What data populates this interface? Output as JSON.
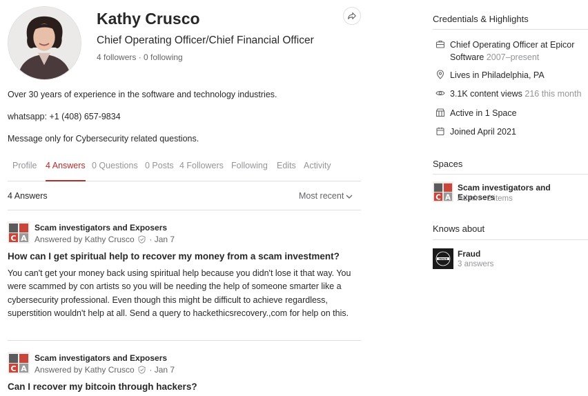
{
  "profile": {
    "name": "Kathy Crusco",
    "headline": "Chief Operating Officer/Chief Financial Officer",
    "follow_stats": "4 followers · 0 following",
    "bio_lines": [
      "Over 30 years of experience in the software and technology industries.",
      "whatsapp: +1 (408) 657-9834",
      "Message only for Cybersecurity related questions."
    ]
  },
  "tabs": [
    {
      "label": "Profile",
      "active": false
    },
    {
      "label": "4 Answers",
      "active": true
    },
    {
      "label": "0 Questions",
      "active": false
    },
    {
      "label": "0 Posts",
      "active": false
    },
    {
      "label": "4 Followers",
      "active": false
    },
    {
      "label": "Following",
      "active": false
    },
    {
      "label": "Edits",
      "active": false
    },
    {
      "label": "Activity",
      "active": false
    }
  ],
  "feed": {
    "count_label": "4 Answers",
    "sort_label": "Most recent",
    "answers": [
      {
        "space": "Scam investigators and Exposers",
        "answered_by": "Answered by Kathy Crusco",
        "date": "· Jan 7",
        "question": "How can I get spiritual help to recover my money from a scam investment?",
        "body": "You can't get your money back using spiritual help because you didn't lose it that way. You were scammed by con artists so you will be needing the help of someone smarter like a cybersecurity professional. Even though this might be difficult to achieve regardless, superstition wouldn't help at all. Send a query to hackethicsrecovery.,com for help on this."
      },
      {
        "space": "Scam investigators and Exposers",
        "answered_by": "Answered by Kathy Crusco",
        "date": "· Jan 7",
        "question": "Can I recover my bitcoin through hackers?",
        "body": ""
      }
    ]
  },
  "sidebar": {
    "credentials_title": "Credentials & Highlights",
    "credentials": [
      {
        "icon": "briefcase-icon",
        "text": "Chief Operating Officer at Epicor Software",
        "muted": "2007–present"
      },
      {
        "icon": "location-pin-icon",
        "text": "Lives in Philadelphia, PA",
        "muted": ""
      },
      {
        "icon": "eye-icon",
        "text": "3.1K content views",
        "muted": "216 this month"
      },
      {
        "icon": "spaces-icon",
        "text": "Active in 1 Space",
        "muted": ""
      },
      {
        "icon": "calendar-icon",
        "text": "Joined April 2021",
        "muted": ""
      }
    ],
    "spaces_title": "Spaces",
    "spaces": [
      {
        "name": "Scam investigators and Exposers",
        "sub": "Admin · 2 items"
      }
    ],
    "knows_title": "Knows about",
    "topics": [
      {
        "name": "Fraud",
        "sub": "3 answers",
        "logo_text": "FRAUD"
      }
    ]
  },
  "colors": {
    "accent": "#b92b27",
    "text": "#282829",
    "muted": "#939598",
    "divider": "#dee0e1"
  }
}
